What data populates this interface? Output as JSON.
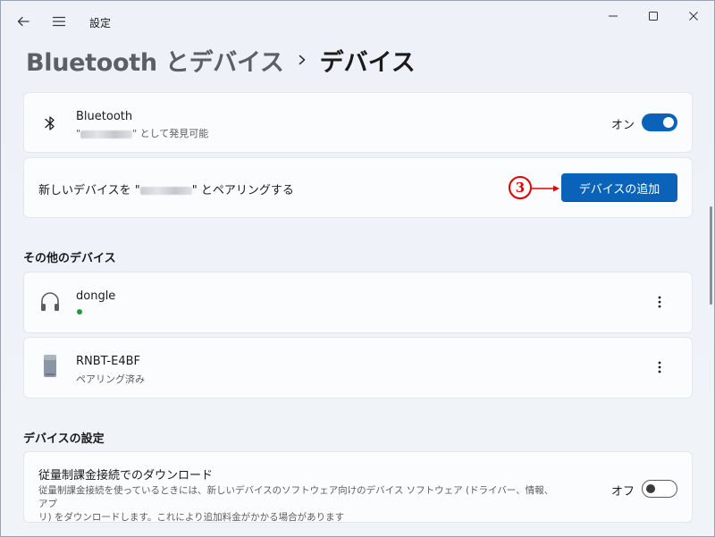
{
  "window": {
    "title": "設定"
  },
  "breadcrumb": {
    "parent": "Bluetooth とデバイス",
    "current": "デバイス"
  },
  "bluetooth": {
    "title": "Bluetooth",
    "subtitle_prefix": "\"",
    "subtitle_suffix": "\" として発見可能",
    "toggle_label": "オン",
    "toggle_state": "on",
    "accent_color": "#0a63b8"
  },
  "pair": {
    "prefix": "新しいデバイスを \"",
    "suffix": "\" とペアリングする",
    "button_label": "デバイスの追加",
    "step_number": "3",
    "annotation_color": "#e10000"
  },
  "other_devices": {
    "heading": "その他のデバイス",
    "items": [
      {
        "name": "dongle",
        "status": "",
        "icon": "headphones-icon",
        "status_dot_color": "#1a9c3a"
      },
      {
        "name": "RNBT-E4BF",
        "status": "ペアリング済み",
        "icon": "device-icon"
      }
    ]
  },
  "device_settings": {
    "heading": "デバイスの設定",
    "metered": {
      "title": "従量制課金接続でのダウンロード",
      "description_line1": "従量制課金接続を使っているときには、新しいデバイスのソフトウェア向けのデバイス ソフトウェア (ドライバー、情報、アプ",
      "description_line2": "リ) をダウンロードします。これにより追加料金がかかる場合があります",
      "toggle_label": "オフ",
      "toggle_state": "off"
    }
  }
}
